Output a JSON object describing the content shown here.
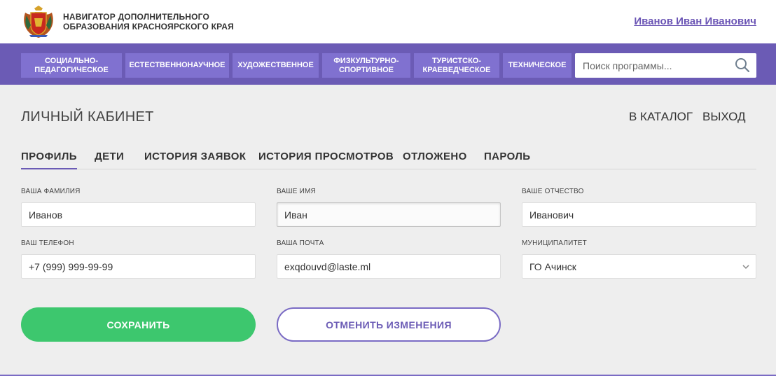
{
  "header": {
    "brand_line1": "НАВИГАТОР ДОПОЛНИТЕЛЬНОГО",
    "brand_line2": "ОБРАЗОВАНИЯ КРАСНОЯРСКОГО КРАЯ",
    "user_name": "Иванов Иван Иванович",
    "logo_icon": "coat-of-arms-icon"
  },
  "nav": {
    "categories": [
      {
        "line1": "СОЦИАЛЬНО-",
        "line2": "ПЕДАГОГИЧЕСКОЕ"
      },
      {
        "line1": "ЕСТЕСТВЕННОНАУЧНОЕ",
        "line2": ""
      },
      {
        "line1": "ХУДОЖЕСТВЕННОЕ",
        "line2": ""
      },
      {
        "line1": "ФИЗКУЛЬТУРНО-",
        "line2": "СПОРТИВНОЕ"
      },
      {
        "line1": "ТУРИСТСКО-",
        "line2": "КРАЕВЕДЧЕСКОЕ"
      },
      {
        "line1": "ТЕХНИЧЕСКОЕ",
        "line2": ""
      }
    ],
    "search": {
      "placeholder": "Поиск программы...",
      "value": "",
      "icon": "search-icon"
    }
  },
  "page": {
    "title": "ЛИЧНЫЙ КАБИНЕТ",
    "catalog_link": "В КАТАЛОГ",
    "logout_link": "ВЫХОД"
  },
  "tabs": [
    {
      "label": "ПРОФИЛЬ",
      "active": true
    },
    {
      "label": "ДЕТИ",
      "active": false
    },
    {
      "label": "ИСТОРИЯ ЗАЯВОК",
      "active": false
    },
    {
      "label": "ИСТОРИЯ ПРОСМОТРОВ",
      "active": false
    },
    {
      "label": "ОТЛОЖЕНО",
      "active": false
    },
    {
      "label": "ПАРОЛЬ",
      "active": false
    }
  ],
  "form": {
    "surname": {
      "label": "ВАША ФАМИЛИЯ",
      "value": "Иванов"
    },
    "name": {
      "label": "ВАШЕ ИМЯ",
      "value": "Иван"
    },
    "patronymic": {
      "label": "ВАШЕ ОТЧЕСТВО",
      "value": "Иванович"
    },
    "phone": {
      "label": "ВАШ ТЕЛЕФОН",
      "value": "+7 (999) 999-99-99"
    },
    "email": {
      "label": "ВАША ПОЧТА",
      "value": "exqdouvd@laste.ml"
    },
    "municipality": {
      "label": "МУНИЦИПАЛИТЕТ",
      "value": "ГО Ачинск"
    }
  },
  "buttons": {
    "save": "СОХРАНИТЬ",
    "cancel": "ОТМЕНИТЬ ИЗМЕНЕНИЯ"
  },
  "colors": {
    "nav_bg": "#6b5bb5",
    "nav_item_bg": "#8071d0",
    "save_green": "#3dc76e",
    "accent_purple": "#6b5bb5",
    "page_bg": "#eeeeee"
  }
}
